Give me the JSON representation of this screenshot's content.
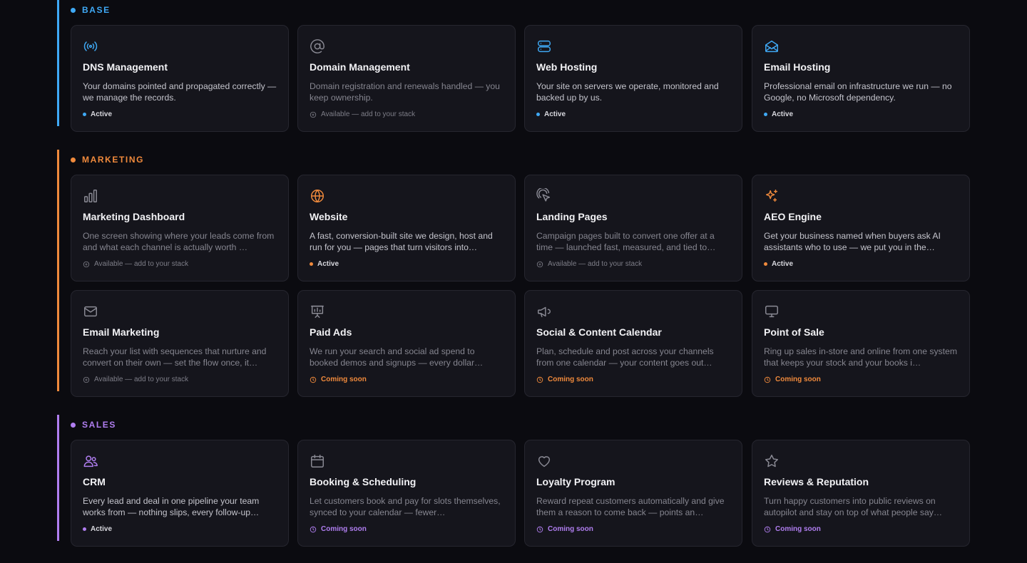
{
  "colors": {
    "base": "#3fa9f5",
    "marketing": "#f08a3c",
    "sales": "#b07ef0",
    "muted": "#7d7d87"
  },
  "sections": [
    {
      "key": "base",
      "label": "BASE",
      "cards": [
        {
          "icon": "broadcast-icon",
          "title": "DNS Management",
          "desc": "Your domains pointed and propagated correctly — we manage the records.",
          "status": "active",
          "status_label": "Active"
        },
        {
          "icon": "at-sign-icon",
          "title": "Domain Management",
          "desc": "Domain registration and renewals handled — you keep ownership.",
          "status": "available",
          "status_label": "Available — add to your stack"
        },
        {
          "icon": "server-icon",
          "title": "Web Hosting",
          "desc": "Your site on servers we operate, monitored and backed up by us.",
          "status": "active",
          "status_label": "Active"
        },
        {
          "icon": "mail-open-icon",
          "title": "Email Hosting",
          "desc": "Professional email on infrastructure we run — no Google, no Microsoft dependency.",
          "status": "active",
          "status_label": "Active"
        }
      ]
    },
    {
      "key": "marketing",
      "label": "MARKETING",
      "cards": [
        {
          "icon": "bar-chart-icon",
          "title": "Marketing Dashboard",
          "desc": "One screen showing where your leads come from and what each channel is actually worth …",
          "status": "available",
          "status_label": "Available — add to your stack"
        },
        {
          "icon": "globe-icon",
          "title": "Website",
          "desc": "A fast, conversion-built site we design, host and run for you — pages that turn visitors into…",
          "status": "active",
          "status_label": "Active"
        },
        {
          "icon": "pointer-click-icon",
          "title": "Landing Pages",
          "desc": "Campaign pages built to convert one offer at a time — launched fast, measured, and tied to…",
          "status": "available",
          "status_label": "Available — add to your stack"
        },
        {
          "icon": "sparkles-icon",
          "title": "AEO Engine",
          "desc": "Get your business named when buyers ask AI assistants who to use — we put you in the…",
          "status": "active",
          "status_label": "Active"
        },
        {
          "icon": "mail-icon",
          "title": "Email Marketing",
          "desc": "Reach your list with sequences that nurture and convert on their own — set the flow once, it…",
          "status": "available",
          "status_label": "Available — add to your stack"
        },
        {
          "icon": "presentation-icon",
          "title": "Paid Ads",
          "desc": "We run your search and social ad spend to booked demos and signups — every dollar…",
          "status": "soon",
          "status_label": "Coming soon"
        },
        {
          "icon": "megaphone-icon",
          "title": "Social & Content Calendar",
          "desc": "Plan, schedule and post across your channels from one calendar — your content goes out…",
          "status": "soon",
          "status_label": "Coming soon"
        },
        {
          "icon": "monitor-icon",
          "title": "Point of Sale",
          "desc": "Ring up sales in-store and online from one system that keeps your stock and your books i…",
          "status": "soon",
          "status_label": "Coming soon"
        }
      ]
    },
    {
      "key": "sales",
      "label": "SALES",
      "cards": [
        {
          "icon": "users-icon",
          "title": "CRM",
          "desc": "Every lead and deal in one pipeline your team works from — nothing slips, every follow-up…",
          "status": "active",
          "status_label": "Active"
        },
        {
          "icon": "calendar-icon",
          "title": "Booking & Scheduling",
          "desc": "Let customers book and pay for slots themselves, synced to your calendar — fewer…",
          "status": "soon",
          "status_label": "Coming soon"
        },
        {
          "icon": "heart-icon",
          "title": "Loyalty Program",
          "desc": "Reward repeat customers automatically and give them a reason to come back — points an…",
          "status": "soon",
          "status_label": "Coming soon"
        },
        {
          "icon": "star-icon",
          "title": "Reviews & Reputation",
          "desc": "Turn happy customers into public reviews on autopilot and stay on top of what people say…",
          "status": "soon",
          "status_label": "Coming soon"
        }
      ]
    }
  ]
}
